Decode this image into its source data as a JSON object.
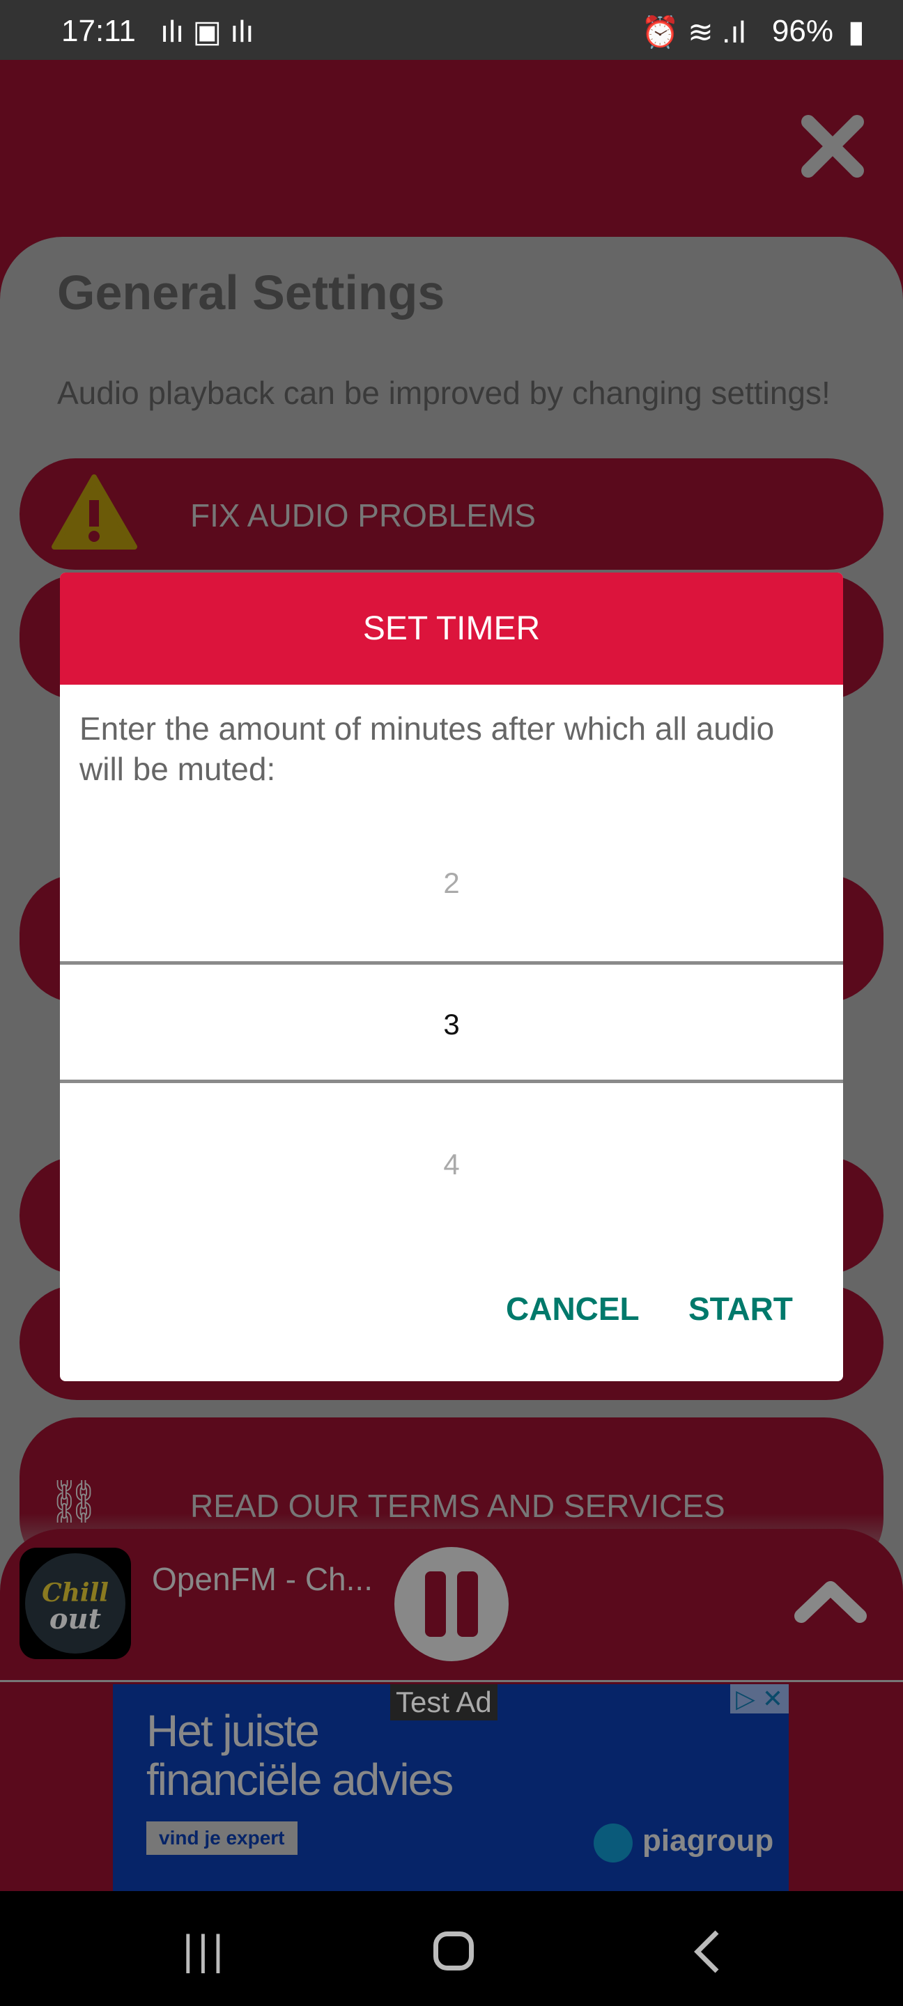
{
  "status_bar": {
    "time": "17:11",
    "battery": "96%"
  },
  "colors": {
    "accent": "#dc143c",
    "button_text": "#00796b",
    "background": "#5a0a1c"
  },
  "page": {
    "title": "General Settings",
    "subtitle": "Audio playback can be improved by changing settings!",
    "buttons": [
      {
        "label": "FIX AUDIO PROBLEMS",
        "icon": "warning-icon"
      },
      {
        "label": "READ OUR TERMS AND SERVICES",
        "icon": "handshake-icon"
      }
    ]
  },
  "dialog": {
    "title": "SET TIMER",
    "message": "Enter the amount of minutes after which all audio will be muted:",
    "picker": {
      "previous": "2",
      "selected": "3",
      "next": "4"
    },
    "cancel": "CANCEL",
    "start": "START"
  },
  "player": {
    "station": "OpenFM - Ch...",
    "logo_text": [
      "Chill",
      "out"
    ]
  },
  "ad": {
    "label": "Test Ad",
    "headline1": "Het juiste",
    "headline2": "financiële advies",
    "cta": "vind je expert",
    "brand": "piagroup"
  }
}
